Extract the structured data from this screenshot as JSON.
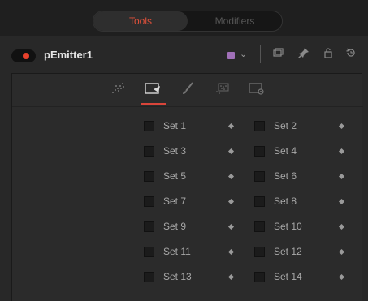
{
  "tabs": [
    {
      "label": "Tools",
      "active": true
    },
    {
      "label": "Modifiers",
      "active": false
    }
  ],
  "tool": {
    "name": "pEmitter1",
    "enabled": true,
    "color": "#a070b8"
  },
  "header_icons": [
    "versions-icon",
    "pin-icon",
    "lock-icon",
    "reset-icon"
  ],
  "subtabs": [
    "particle-controls-icon",
    "region-icon",
    "style-icon",
    "sets-icon",
    "settings-icon"
  ],
  "active_subtab": "region-icon",
  "sets": [
    {
      "label": "Set 1",
      "checked": false
    },
    {
      "label": "Set 2",
      "checked": false
    },
    {
      "label": "Set 3",
      "checked": false
    },
    {
      "label": "Set 4",
      "checked": false
    },
    {
      "label": "Set 5",
      "checked": false
    },
    {
      "label": "Set 6",
      "checked": false
    },
    {
      "label": "Set 7",
      "checked": false
    },
    {
      "label": "Set 8",
      "checked": false
    },
    {
      "label": "Set 9",
      "checked": false
    },
    {
      "label": "Set 10",
      "checked": false
    },
    {
      "label": "Set 11",
      "checked": false
    },
    {
      "label": "Set 12",
      "checked": false
    },
    {
      "label": "Set 13",
      "checked": false
    },
    {
      "label": "Set 14",
      "checked": false
    }
  ],
  "colors": {
    "accent": "#e0503a",
    "enabled_dot": "#e8412c"
  }
}
